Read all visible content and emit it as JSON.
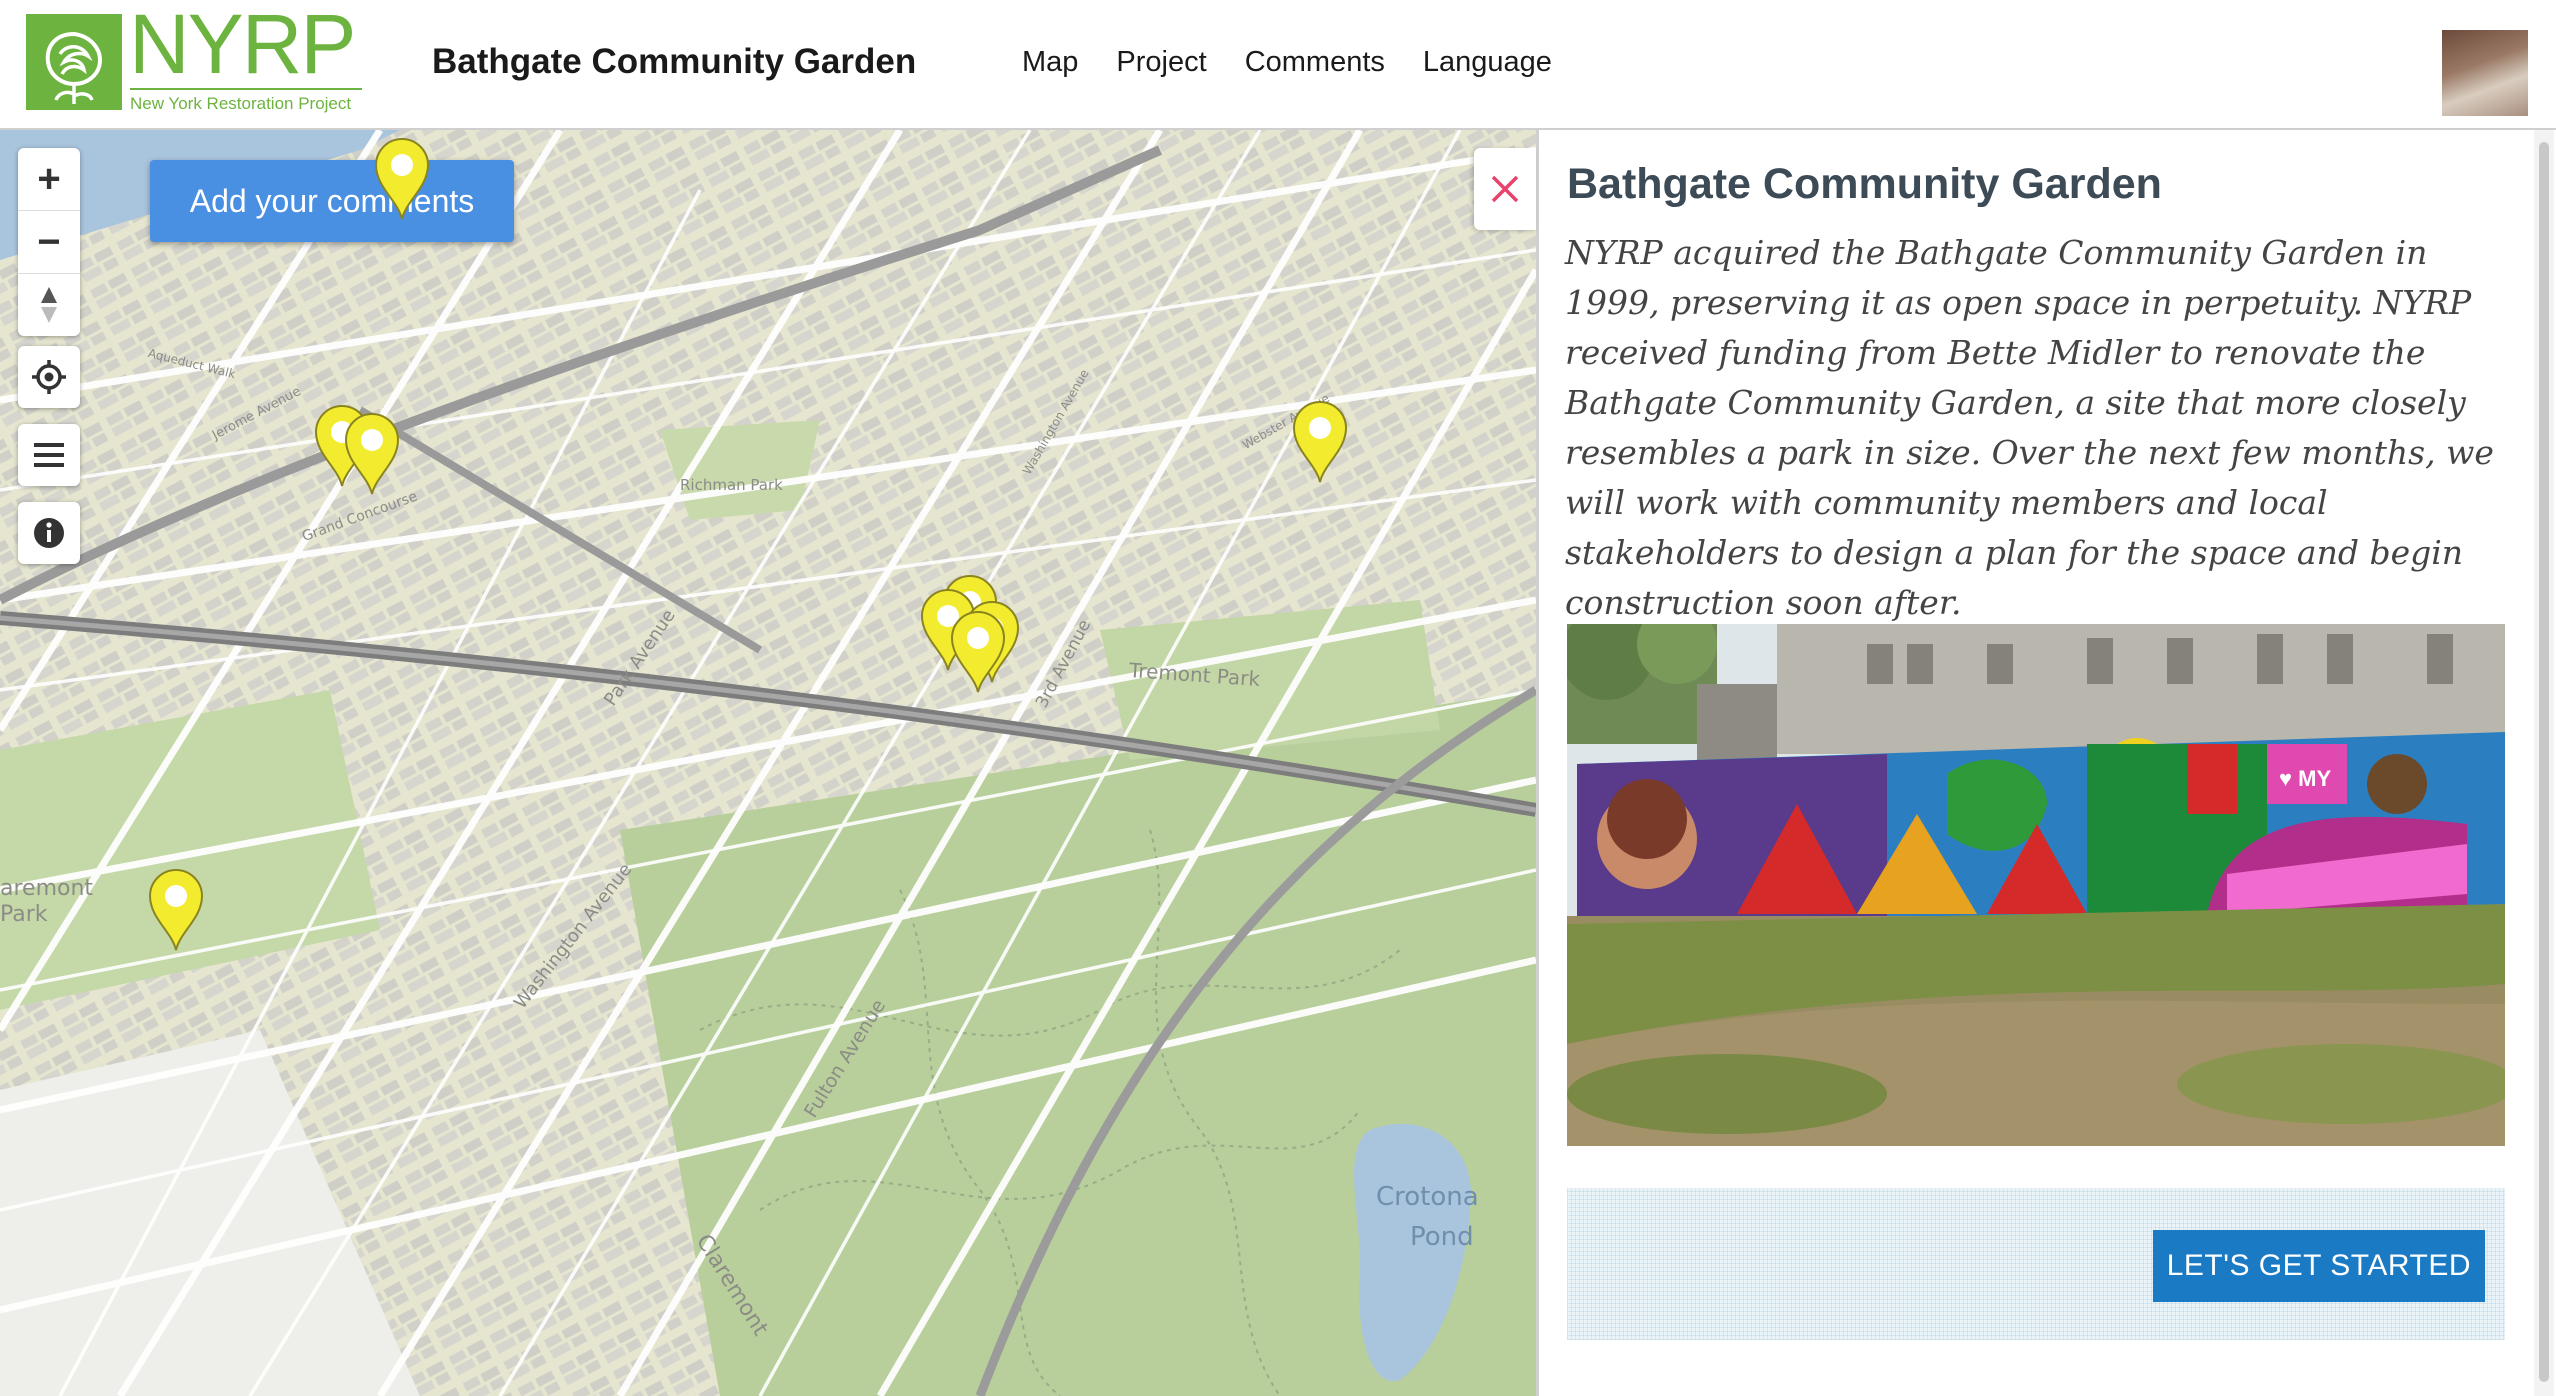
{
  "header": {
    "logo_text": "NYRP",
    "logo_subtitle": "New York Restoration Project",
    "site_title": "Bathgate Community Garden",
    "nav": [
      "Map",
      "Project",
      "Comments",
      "Language"
    ]
  },
  "map": {
    "add_comments_label": "Add your comments",
    "controls": {
      "zoom_in": "+",
      "zoom_out": "−",
      "compass": "north-arrow-icon",
      "locate": "locate-icon",
      "layers": "layers-menu-icon",
      "info": "info-icon"
    },
    "labels": {
      "tremont_park": "Tremont Park",
      "richman_park": "Richman Park",
      "park_avenue": "Park Avenue",
      "washington_avenue": "Washington Avenue",
      "fulton_avenue": "Fulton Avenue",
      "third_avenue": "3rd Avenue",
      "claremont_park": "aremont Park",
      "claremont_bottom": "Claremont",
      "crotona_pond_1": "Crotona",
      "crotona_pond_2": "Pond",
      "aqueduct_walk": "Aqueduct Walk",
      "jerome_avenue": "Jerome Avenue",
      "grand_concourse": "Grand Concourse",
      "webster_avenue": "Webster Avenue",
      "washington_ave_n": "Washington Avenue"
    },
    "pin_color": "#f3ec2e"
  },
  "panel": {
    "close_icon": "close-icon",
    "title": "Bathgate Community Garden",
    "description": "NYRP acquired the Bathgate Community Garden in 1999, preserving it as open space in perpetuity. NYRP received funding from Bette Midler to renovate the Bathgate Community Garden, a site that more closely resembles a park in size. Over the next few months, we will work with community members and local stakeholders to design a plan for the space and begin construction soon after.",
    "photo_alt": "Garden lot with a colorful mural fence",
    "cta_label": "LET'S GET STARTED"
  },
  "colors": {
    "brand_green": "#6db33f",
    "button_blue": "#4a90e2",
    "cta_blue": "#1a7ac4",
    "close_pink": "#e8426b"
  }
}
